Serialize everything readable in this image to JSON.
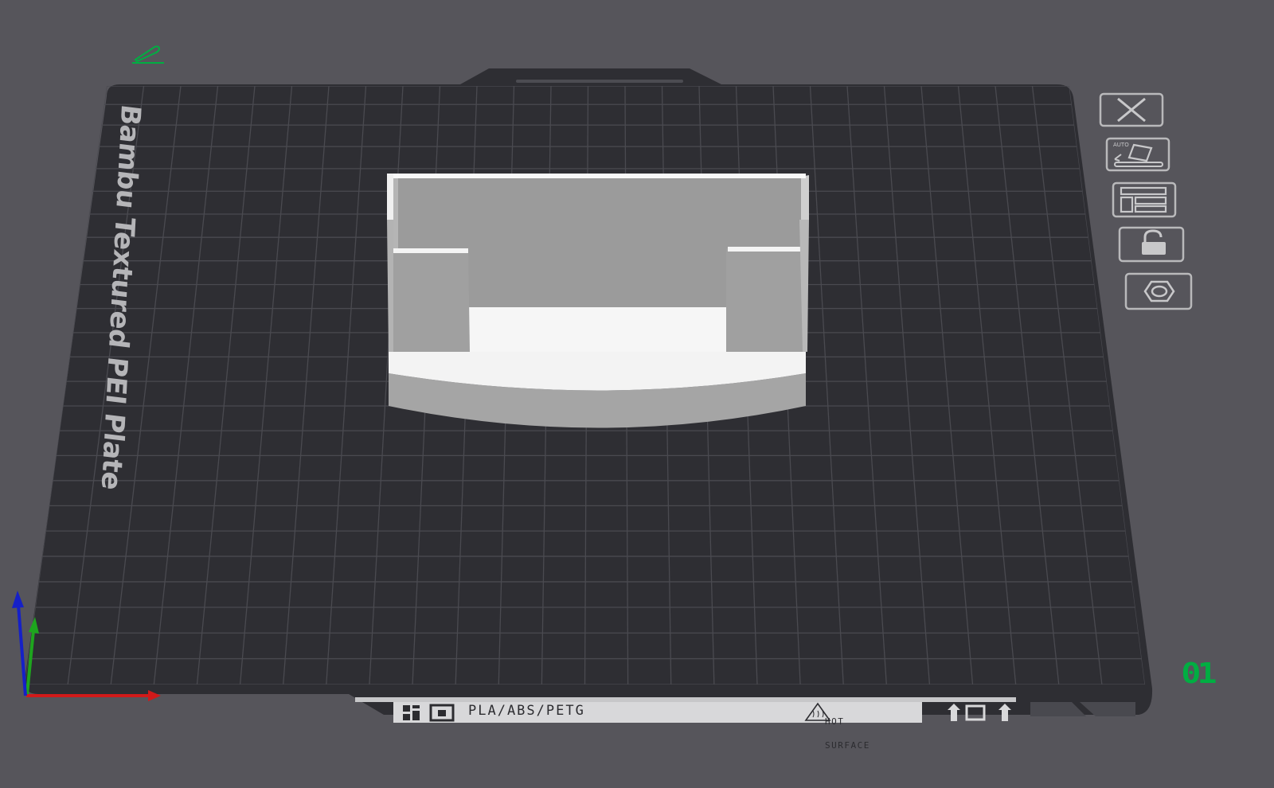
{
  "plate": {
    "name": "Bambu Textured PEI Plate",
    "number": "01"
  },
  "plate_strip": {
    "filaments": "PLA/ABS/PETG",
    "warning_line1": "HOT",
    "warning_line2": "SURFACE"
  },
  "toolbar": {
    "items": [
      {
        "name": "delete-plate",
        "icon": "close-icon"
      },
      {
        "name": "auto-orient",
        "icon": "auto-orient-icon",
        "label": "AUTO"
      },
      {
        "name": "arrange",
        "icon": "arrange-icon"
      },
      {
        "name": "lock-plate",
        "icon": "lock-icon"
      },
      {
        "name": "plate-settings",
        "icon": "hexagon-settings-icon"
      }
    ]
  },
  "colors": {
    "background": "#56555b",
    "plate": "#2e2e33",
    "grid": "#4a4a50",
    "model_top": "#f2f2f2",
    "model_side": "#a2a2a2",
    "accent_green": "#00ae42",
    "axis_x": "#d11a1a",
    "axis_y": "#1ea51e",
    "axis_z": "#1520c8"
  },
  "icons": {
    "edit": "edit-plate-name-icon"
  }
}
